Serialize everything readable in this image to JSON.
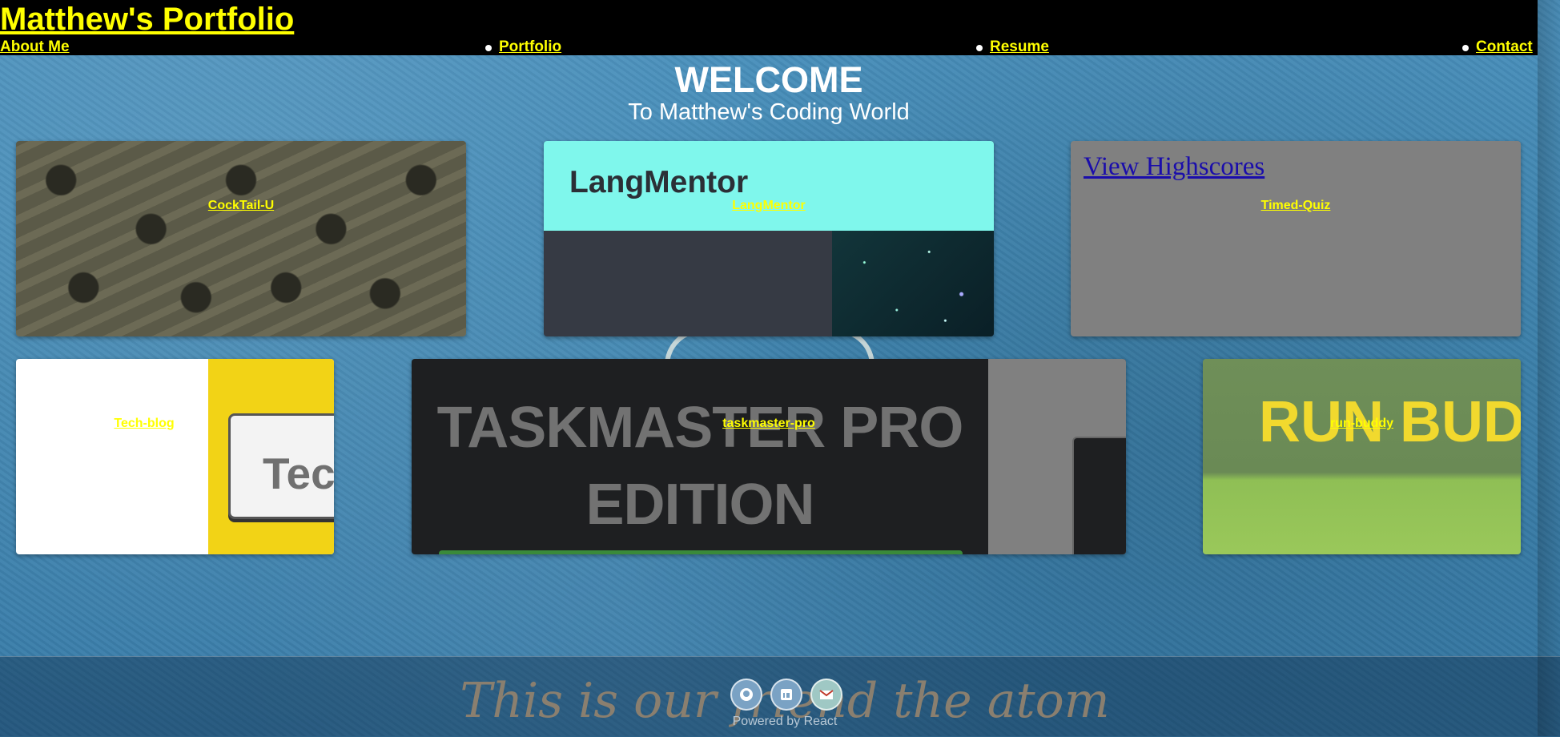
{
  "header": {
    "title": "Matthew's Portfolio",
    "nav": [
      {
        "label": "About Me"
      },
      {
        "label": "Portfolio"
      },
      {
        "label": "Resume"
      },
      {
        "label": "Contact"
      }
    ]
  },
  "hero": {
    "heading": "WELCOME",
    "subheading": "To Matthew's Coding World"
  },
  "projects": [
    {
      "name": "CockTail-U"
    },
    {
      "name": "LangMentor",
      "thumbnail_text": "LangMentor"
    },
    {
      "name": "Timed-Quiz",
      "thumbnail_text": "View Highscores"
    },
    {
      "name": "Tech-blog",
      "thumbnail_text": "Tec"
    },
    {
      "name": "taskmaster-pro",
      "thumbnail_text": "TASKMASTER PRO EDITION"
    },
    {
      "name": "run-buddy",
      "thumbnail_text": "RUN BUD"
    }
  ],
  "footer": {
    "tagline": "This is our friend the atom",
    "icons": [
      "github-icon",
      "linkedin-icon",
      "email-icon"
    ],
    "powered_by": "Powered by React"
  },
  "colors": {
    "header_bg": "#000000",
    "link": "#ffff00",
    "page_bg": "#3f86b3",
    "langmentor_banner": "#7ff7ec",
    "highscores_link": "#1a0dab"
  }
}
